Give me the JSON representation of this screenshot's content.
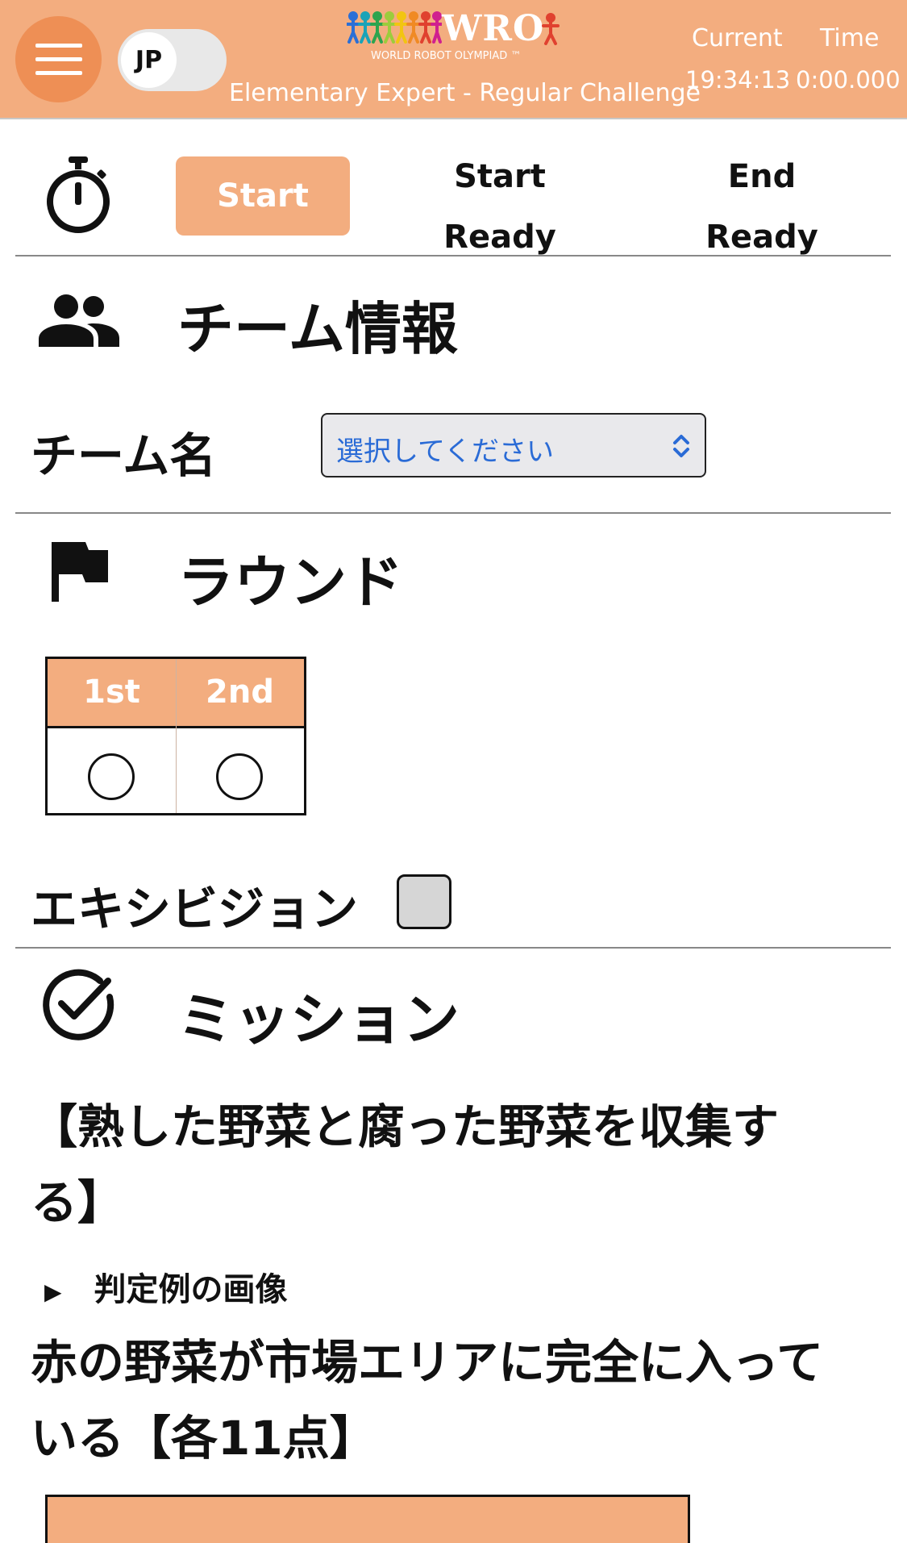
{
  "header": {
    "lang_toggle": "JP",
    "logo_text": "WRO",
    "logo_sub": "WORLD ROBOT OLYMPIAD ™",
    "subtitle": "Elementary Expert - Regular Challenge",
    "clock": {
      "current_label": "Current",
      "time_label": "Time",
      "current_value": "19:34:13",
      "time_value": "0:00.000"
    },
    "brand_color": "#f3ad7f",
    "menu_color": "#ee8f55"
  },
  "timer": {
    "start_label": "Start",
    "start_status_line1": "Start",
    "start_status_line2": "Ready",
    "end_status_line1": "End",
    "end_status_line2": "Ready"
  },
  "team": {
    "title": "チーム情報",
    "name_label": "チーム名",
    "select_placeholder": "選択してください"
  },
  "round": {
    "title": "ラウンド",
    "options": [
      "1st",
      "2nd"
    ],
    "exhibition_label": "エキシビジョン"
  },
  "mission": {
    "title": "ミッション",
    "heading_line1": "【熟した野菜と腐った野菜を収集す",
    "heading_line2": "る】",
    "details_label": "判定例の画像",
    "item_line1": "赤の野菜が市場エリアに完全に入って",
    "item_line2": "いる【各11点】"
  }
}
